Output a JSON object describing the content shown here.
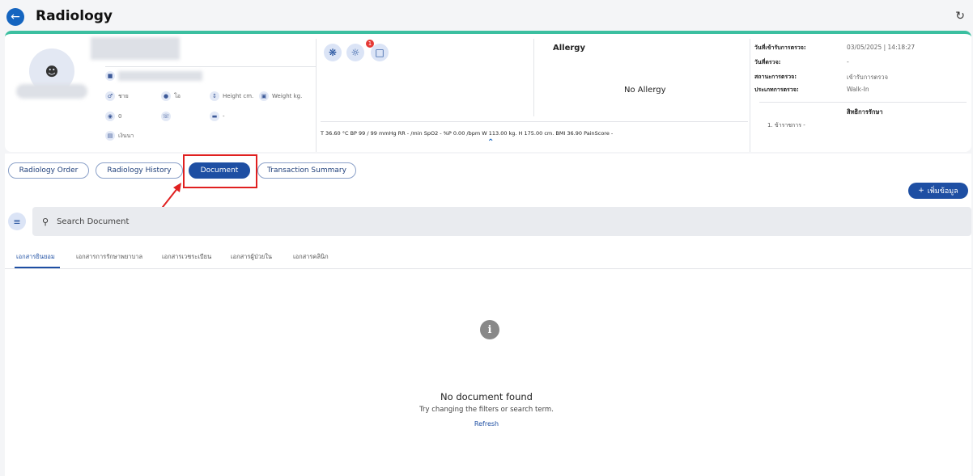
{
  "header": {
    "title": "Radiology",
    "back_icon": "arrow-left-icon",
    "refresh_icon": "refresh-icon"
  },
  "patient": {
    "gender": "ชาย",
    "blood_type": "โอ",
    "height": "Height cm.",
    "weight": "Weight kg.",
    "age_value": "0",
    "extra_value": "-",
    "payment": "เงินนา"
  },
  "allergy": {
    "title": "Allergy",
    "value": "No Allergy"
  },
  "vitals": "T 36.60 °C BP 99 / 99 mmHg RR - /min SpO2 - %P 0.00 /bpm W 113.00 kg. H 175.00 cm. BMI 36.90 PainScore -",
  "visit": {
    "rows": [
      {
        "label": "วันที่เข้ารับการตรวจ:",
        "value": "03/05/2025 | 14:18:27"
      },
      {
        "label": "วันที่ตรวจ:",
        "value": "-"
      },
      {
        "label": "สถานะการตรวจ:",
        "value": "เข้ารับการตรวจ"
      },
      {
        "label": "ประเภทการตรวจ:",
        "value": "Walk-In"
      }
    ],
    "rights_title": "สิทธิการรักษา",
    "rights_item": "1.  ข้าราชการ -"
  },
  "notification_count": "1",
  "tabs": [
    {
      "label": "Radiology Order",
      "active": false
    },
    {
      "label": "Radiology History",
      "active": false
    },
    {
      "label": "Document",
      "active": true
    },
    {
      "label": "Transaction Summary",
      "active": false
    }
  ],
  "add_button": "เพิ่มข้อมูล",
  "search": {
    "placeholder": "Search Document"
  },
  "doc_tabs": [
    {
      "label": "เอกสารยินยอม",
      "active": true
    },
    {
      "label": "เอกสารการรักษาพยาบาล",
      "active": false
    },
    {
      "label": "เอกสารเวชระเบียน",
      "active": false
    },
    {
      "label": "เอกสารผู้ป่วยใน",
      "active": false
    },
    {
      "label": "เอกสารคลินิก",
      "active": false
    }
  ],
  "empty_state": {
    "title": "No document found",
    "subtitle": "Try changing the filters or search term.",
    "action": "Refresh"
  },
  "colors": {
    "primary": "#1e4fa3",
    "accent_bar": "#3bbfa0",
    "highlight": "#e02020"
  }
}
